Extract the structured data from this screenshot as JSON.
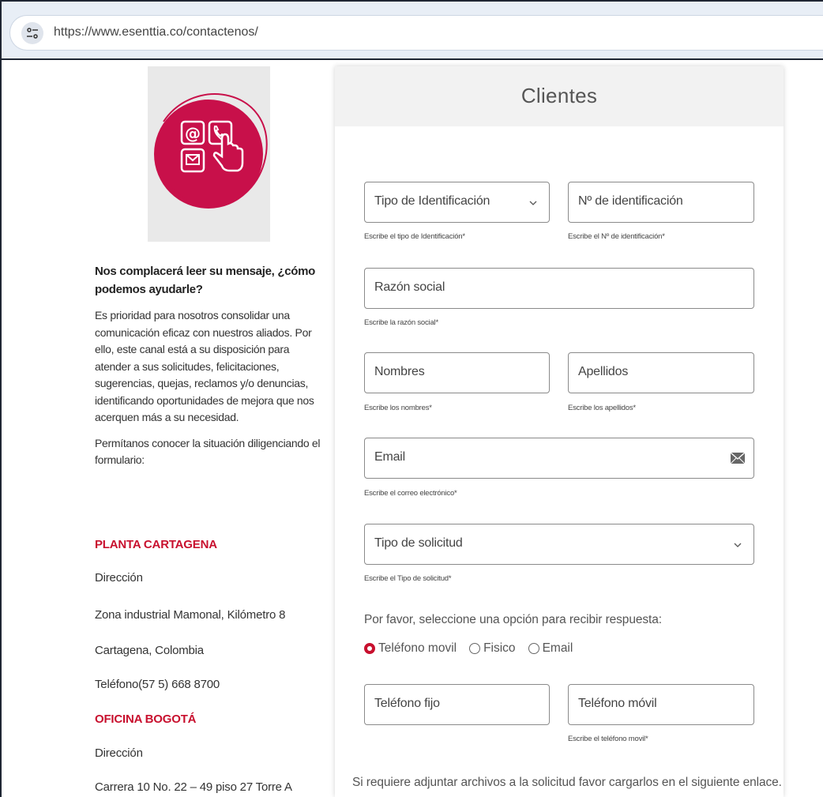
{
  "browser": {
    "url": "https://www.esenttia.co/contactenos/"
  },
  "sidebar": {
    "intro_title": "Nos complacerá leer su mensaje, ¿cómo podemos ayudarle?",
    "intro_body": "Es prioridad para nosotros consolidar una comunicación eficaz con nuestros aliados. Por ello, este canal está a su disposición para atender a sus solicitudes, felicitaciones, sugerencias, quejas, reclamos y/o denuncias, identificando oportunidades de mejora que nos acerquen más a su necesidad.",
    "intro_cta": "Permítanos conocer la situación diligenciando el formulario:",
    "offices": [
      {
        "name": "PLANTA CARTAGENA",
        "address_label": "Dirección",
        "address": "Zona industrial Mamonal, Kilómetro 8",
        "city": "Cartagena, Colombia",
        "phone": "Teléfono(57 5) 668 8700"
      },
      {
        "name": "OFICINA BOGOTÁ",
        "address_label": "Dirección",
        "address": "Carrera 10 No. 22 – 49 piso 27 Torre A"
      }
    ]
  },
  "form": {
    "title": "Clientes",
    "fields": {
      "id_type": {
        "label": "Tipo de Identificación",
        "help": "Escribe el tipo de Identificación*"
      },
      "id_number": {
        "label": "Nº de identificación",
        "help": "Escribe el Nº de identificación*"
      },
      "company": {
        "label": "Razón social",
        "help": "Escribe la razón social*"
      },
      "first_names": {
        "label": "Nombres",
        "help": "Escribe los nombres*"
      },
      "last_names": {
        "label": "Apellidos",
        "help": "Escribe los apellidos*"
      },
      "email": {
        "label": "Email",
        "help": "Escribe el correo electrónico*"
      },
      "request_type": {
        "label": "Tipo de solicitud",
        "help": "Escribe el Tipo de solicitud*"
      },
      "landline": {
        "label": "Teléfono fijo"
      },
      "mobile": {
        "label": "Teléfono móvil",
        "help": "Escribe el teléfono movil*"
      }
    },
    "response_question": "Por favor, seleccione una opción para recibir respuesta:",
    "response_options": [
      {
        "label": "Teléfono movil",
        "selected": true
      },
      {
        "label": "Fisico",
        "selected": false
      },
      {
        "label": "Email",
        "selected": false
      }
    ],
    "attach_note": "Si requiere adjuntar archivos a la solicitud favor cargarlos en el siguiente enlace."
  },
  "colors": {
    "brand": "#c8102e",
    "logo_circle": "#c8104a"
  }
}
